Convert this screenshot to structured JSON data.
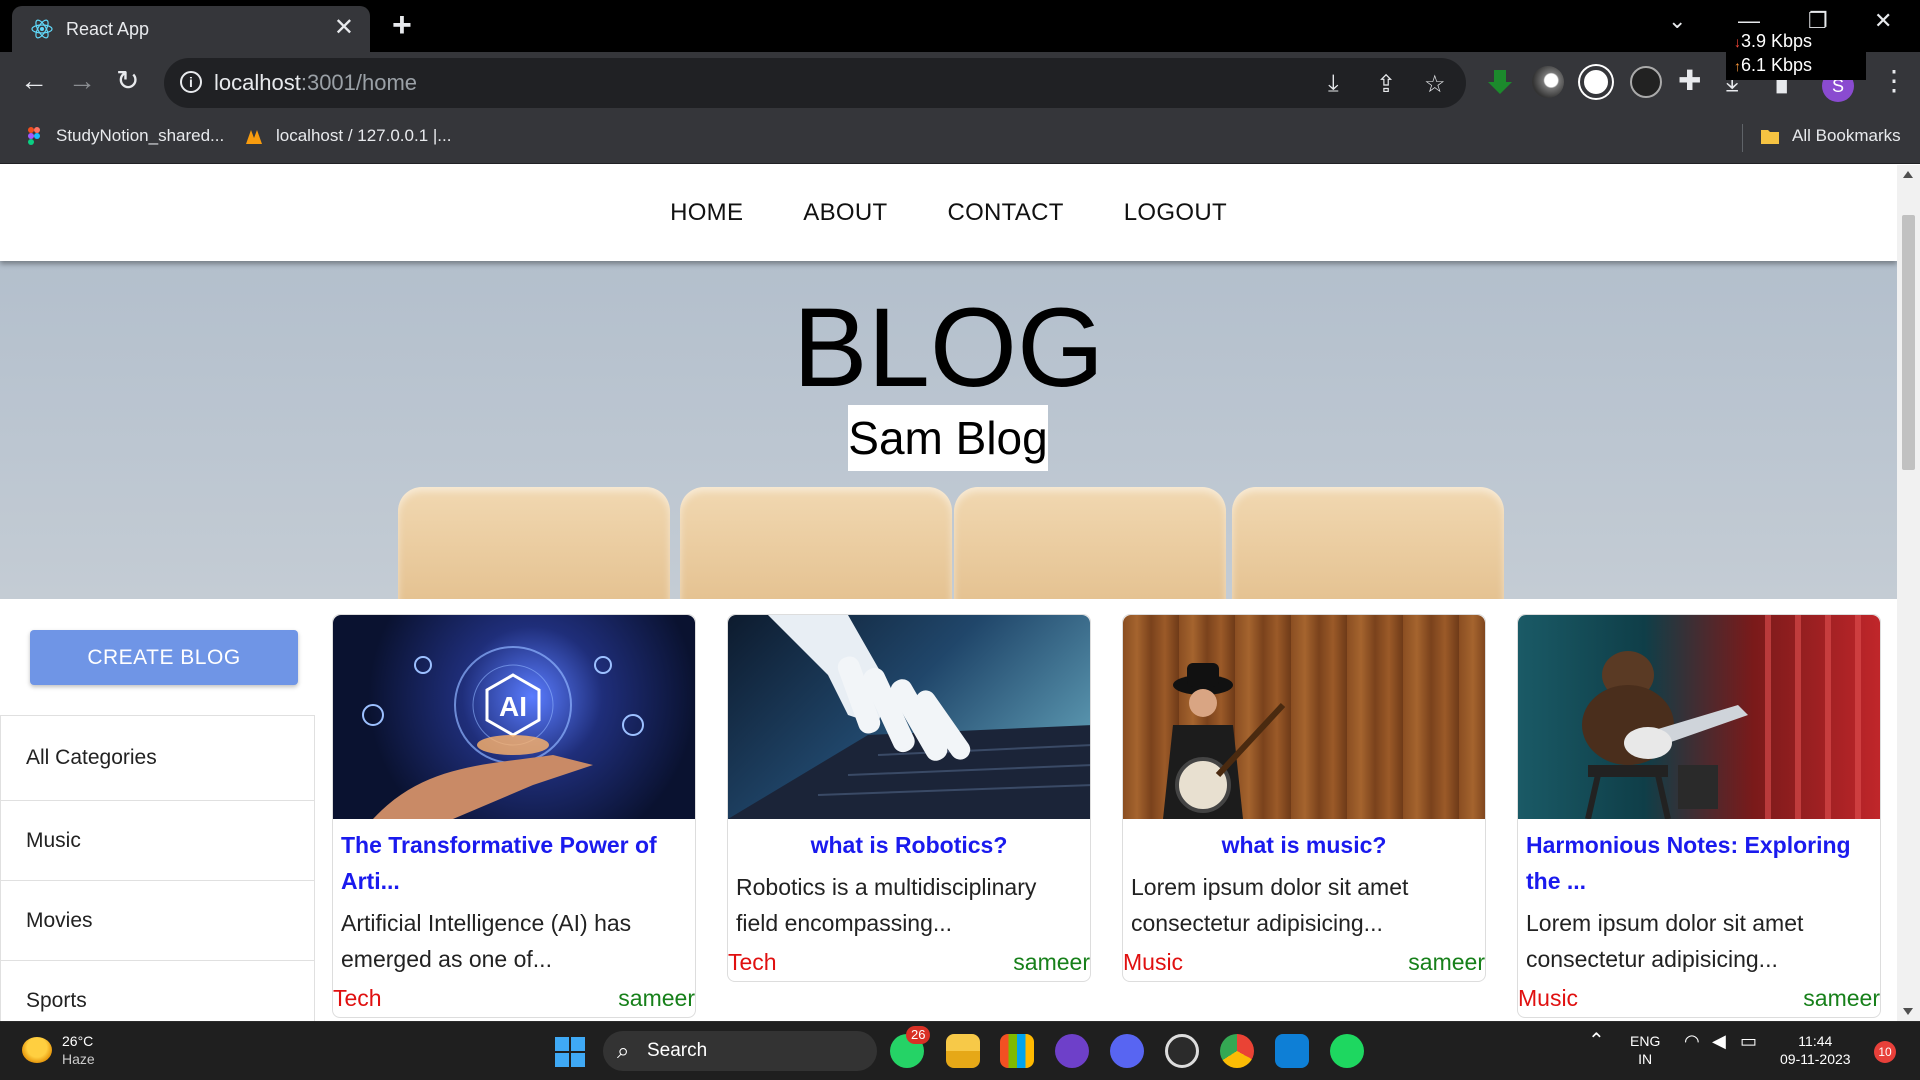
{
  "browser": {
    "tab_title": "React App",
    "url_host": "localhost",
    "url_path": ":3001/home",
    "net_down": "3.9 Kbps",
    "net_up": "6.1 Kbps",
    "profile_initial": "S",
    "bookmarks": [
      "StudyNotion_shared...",
      "localhost / 127.0.0.1 |..."
    ],
    "all_bookmarks": "All Bookmarks"
  },
  "nav": {
    "links": [
      "HOME",
      "ABOUT",
      "CONTACT",
      "LOGOUT"
    ]
  },
  "hero": {
    "title": "BLOG",
    "subtitle": "Sam Blog"
  },
  "sidebar": {
    "create_label": "CREATE BLOG",
    "categories": [
      "All Categories",
      "Music",
      "Movies",
      "Sports"
    ]
  },
  "posts": [
    {
      "title": "The Transformative Power of Arti...",
      "description": "Artificial Intelligence (AI) has emerged as one of...",
      "category": "Tech",
      "author": "sameer",
      "image_label": "AI"
    },
    {
      "title": "what is Robotics?",
      "description": "Robotics is a multidisciplinary field encompassing...",
      "category": "Tech",
      "author": "sameer"
    },
    {
      "title": "what is music?",
      "description": "Lorem ipsum dolor sit amet consectetur adipisicing...",
      "category": "Music",
      "author": "sameer"
    },
    {
      "title": "Harmonious Notes: Exploring the ...",
      "description": "Lorem ipsum dolor sit amet consectetur adipisicing...",
      "category": "Music",
      "author": "sameer"
    }
  ],
  "taskbar": {
    "temperature": "26°C",
    "weather": "Haze",
    "search_label": "Search",
    "whatsapp_badge": "26",
    "lang": "ENG",
    "region": "IN",
    "time": "11:44",
    "date": "09-11-2023",
    "notifications": "10"
  },
  "colors": {
    "link_blue": "#1a1aee",
    "category_red": "#e01010",
    "author_green": "#17801a",
    "button_blue": "#6f95e6"
  }
}
